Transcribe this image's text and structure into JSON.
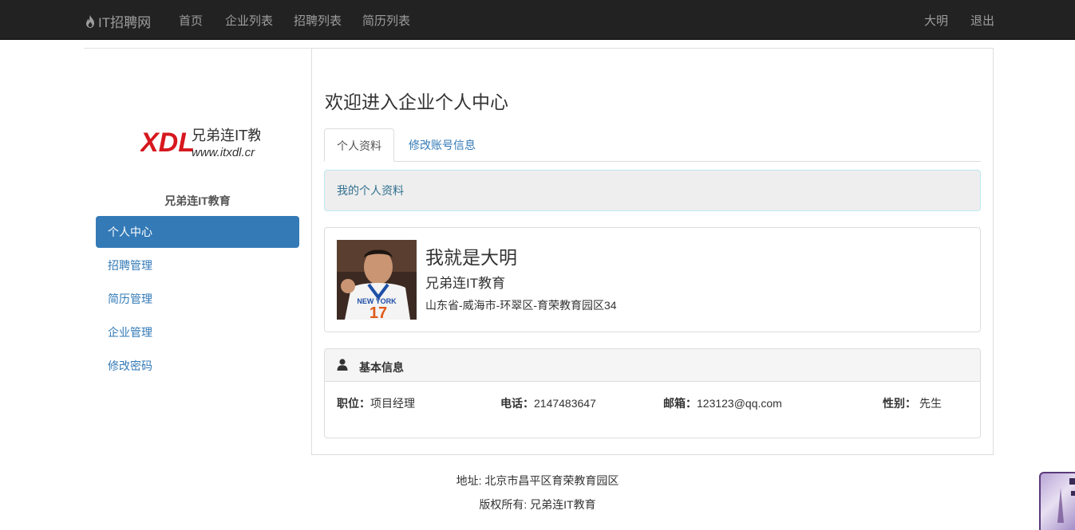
{
  "navbar": {
    "brand": "IT招聘网",
    "links": [
      "首页",
      "企业列表",
      "招聘列表",
      "简历列表"
    ],
    "user": "大明",
    "logout": "退出"
  },
  "sidebar": {
    "logo_text_main": "兄弟连IT教育",
    "logo_text_url": "www.itxdl.cr",
    "logo_mark": "XDL",
    "company_name": "兄弟连IT教育",
    "items": [
      {
        "label": "个人中心",
        "active": true
      },
      {
        "label": "招聘管理"
      },
      {
        "label": "简历管理"
      },
      {
        "label": "企业管理"
      },
      {
        "label": "修改密码"
      }
    ]
  },
  "main": {
    "welcome": "欢迎进入企业个人中心",
    "tabs": [
      {
        "label": "个人资料",
        "active": true
      },
      {
        "label": "修改账号信息"
      }
    ],
    "alert": "我的个人资料",
    "profile": {
      "name": "我就是大明",
      "company": "兄弟连IT教育",
      "address": "山东省-威海市-环翠区-育荣教育园区34",
      "jersey_text": "NEW YORK",
      "jersey_number": "17"
    },
    "basic_info": {
      "title": "基本信息",
      "position_label": "职位：",
      "position_value": "项目经理",
      "phone_label": "电话：",
      "phone_value": "2147483647",
      "email_label": "邮箱：",
      "email_value": "123123@qq.com",
      "gender_label": "性别：",
      "gender_value": "先生"
    }
  },
  "footer": {
    "address": "地址: 北京市昌平区育荣教育园区",
    "copyright": "版权所有: 兄弟连IT教育"
  },
  "colors": {
    "navbar_bg": "#222222",
    "accent": "#337ab7",
    "logo_red": "#d6181e"
  }
}
